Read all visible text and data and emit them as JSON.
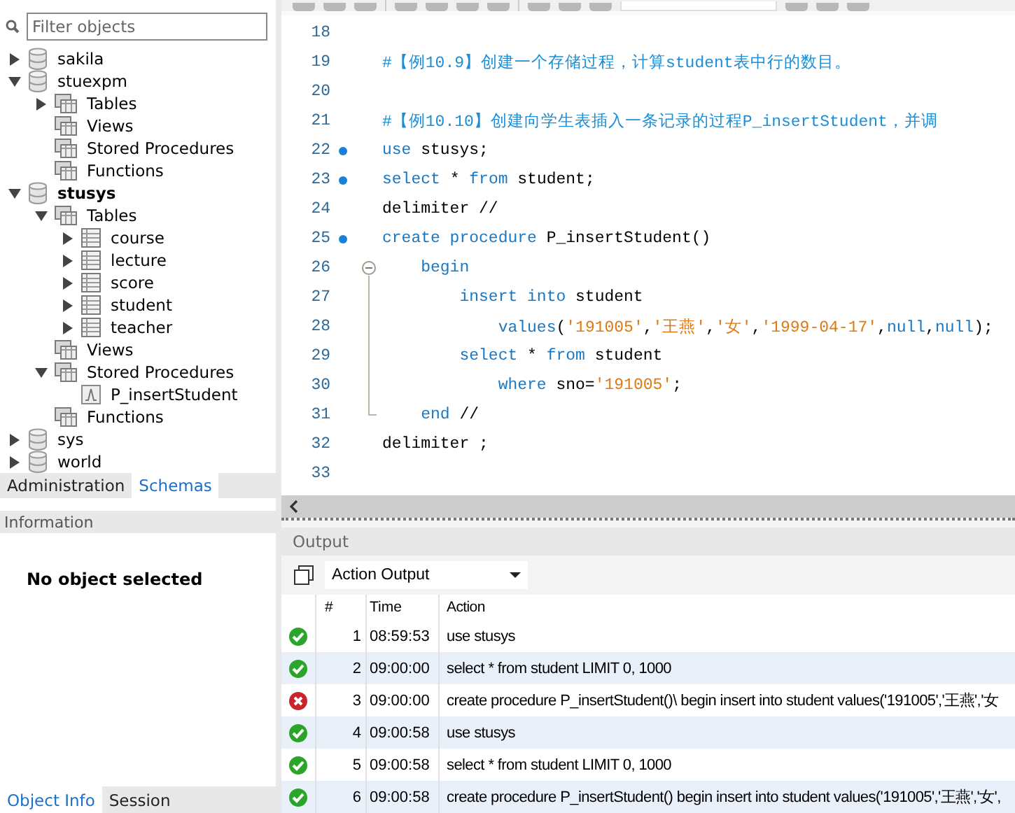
{
  "sidebar": {
    "filter": {
      "placeholder": "Filter objects"
    },
    "tree": [
      {
        "label": "sakila",
        "kind": "schema",
        "default_schema": false,
        "expanded": false
      },
      {
        "label": "stuexpm",
        "kind": "schema",
        "default_schema": false,
        "expanded": true,
        "children": [
          {
            "label": "Tables",
            "kind": "group",
            "expanded": false
          },
          {
            "label": "Views",
            "kind": "group"
          },
          {
            "label": "Stored Procedures",
            "kind": "group"
          },
          {
            "label": "Functions",
            "kind": "group"
          }
        ]
      },
      {
        "label": "stusys",
        "kind": "schema",
        "default_schema": true,
        "expanded": true,
        "children": [
          {
            "label": "Tables",
            "kind": "group",
            "expanded": true,
            "children": [
              {
                "label": "course",
                "kind": "table",
                "expanded": false
              },
              {
                "label": "lecture",
                "kind": "table",
                "expanded": false
              },
              {
                "label": "score",
                "kind": "table",
                "expanded": false
              },
              {
                "label": "student",
                "kind": "table",
                "expanded": false
              },
              {
                "label": "teacher",
                "kind": "table",
                "expanded": false
              }
            ]
          },
          {
            "label": "Views",
            "kind": "group"
          },
          {
            "label": "Stored Procedures",
            "kind": "group",
            "expanded": true,
            "children": [
              {
                "label": "P_insertStudent",
                "kind": "routine"
              }
            ]
          },
          {
            "label": "Functions",
            "kind": "group"
          }
        ]
      },
      {
        "label": "sys",
        "kind": "schema",
        "default_schema": false,
        "expanded": false
      },
      {
        "label": "world",
        "kind": "schema",
        "default_schema": false,
        "expanded": false
      }
    ],
    "tabs": [
      {
        "label": "Administration",
        "selected": false
      },
      {
        "label": "Schemas",
        "selected": true
      }
    ],
    "info_title": "Information",
    "info_text": "No object selected",
    "bottom_tabs": [
      {
        "label": "Object Info",
        "selected": true
      },
      {
        "label": "Session",
        "selected": false
      }
    ]
  },
  "editor": {
    "lines": [
      {
        "num": "18",
        "kind": "plain",
        "marker": false
      },
      {
        "num": "19",
        "kind": "plain",
        "marker": false,
        "tokens": [
          {
            "kind": "comment",
            "s": "#【例10.9】创建一个存储过程，计算student表中行的数目。"
          }
        ]
      },
      {
        "num": "20",
        "kind": "plain",
        "marker": false
      },
      {
        "num": "21",
        "kind": "plain",
        "marker": false,
        "tokens": [
          {
            "kind": "comment",
            "s": "#【例10.10】创建向学生表插入一条记录的过程P_insertStudent，并调"
          }
        ]
      },
      {
        "num": "22",
        "kind": "plain",
        "marker": true,
        "tokens": [
          {
            "kind": "kw",
            "s": "use"
          },
          {
            "kind": "plain",
            "s": " stusys;"
          }
        ]
      },
      {
        "num": "23",
        "kind": "plain",
        "marker": true,
        "tokens": [
          {
            "kind": "kw",
            "s": "select"
          },
          {
            "kind": "plain",
            "s": " * "
          },
          {
            "kind": "kw",
            "s": "from"
          },
          {
            "kind": "plain",
            "s": " student;"
          }
        ]
      },
      {
        "num": "24",
        "kind": "plain",
        "marker": false,
        "tokens": [
          {
            "kind": "plain",
            "s": "delimiter //"
          }
        ]
      },
      {
        "num": "25",
        "kind": "plain",
        "marker": true,
        "tokens": [
          {
            "kind": "kw",
            "s": "create procedure"
          },
          {
            "kind": "plain",
            "s": " P_insertStudent()"
          }
        ]
      },
      {
        "num": "26",
        "kind": "fold_start",
        "marker": false,
        "tokens": [
          {
            "kind": "kw",
            "s": "    begin"
          }
        ]
      },
      {
        "num": "27",
        "kind": "fold_body",
        "marker": false,
        "tokens": [
          {
            "kind": "kw",
            "s": "        insert into"
          },
          {
            "kind": "plain",
            "s": " student"
          }
        ]
      },
      {
        "num": "28",
        "kind": "fold_body",
        "marker": false,
        "tokens": [
          {
            "kind": "kw",
            "s": "            values"
          },
          {
            "kind": "plain",
            "s": "("
          },
          {
            "kind": "str",
            "s": "'191005'"
          },
          {
            "kind": "plain",
            "s": ","
          },
          {
            "kind": "str",
            "s": "'王燕'"
          },
          {
            "kind": "plain",
            "s": ","
          },
          {
            "kind": "str",
            "s": "'女'"
          },
          {
            "kind": "plain",
            "s": ","
          },
          {
            "kind": "str",
            "s": "'1999-04-17'"
          },
          {
            "kind": "plain",
            "s": ","
          },
          {
            "kind": "kw",
            "s": "null"
          },
          {
            "kind": "plain",
            "s": ","
          },
          {
            "kind": "kw",
            "s": "null"
          },
          {
            "kind": "plain",
            "s": ");"
          }
        ]
      },
      {
        "num": "29",
        "kind": "fold_body",
        "marker": false,
        "tokens": [
          {
            "kind": "kw",
            "s": "        select"
          },
          {
            "kind": "plain",
            "s": " * "
          },
          {
            "kind": "kw",
            "s": "from"
          },
          {
            "kind": "plain",
            "s": " student"
          }
        ]
      },
      {
        "num": "30",
        "kind": "fold_body",
        "marker": false,
        "tokens": [
          {
            "kind": "kw",
            "s": "            where"
          },
          {
            "kind": "plain",
            "s": " sno="
          },
          {
            "kind": "str",
            "s": "'191005'"
          },
          {
            "kind": "plain",
            "s": ";"
          }
        ]
      },
      {
        "num": "31",
        "kind": "fold_end",
        "marker": false,
        "tokens": [
          {
            "kind": "kw",
            "s": "    end"
          },
          {
            "kind": "plain",
            "s": " //"
          }
        ]
      },
      {
        "num": "32",
        "kind": "plain",
        "marker": false,
        "tokens": [
          {
            "kind": "plain",
            "s": "delimiter ;"
          }
        ]
      },
      {
        "num": "33",
        "kind": "plain",
        "marker": false
      }
    ]
  },
  "output": {
    "title": "Output",
    "selector": "Action Output",
    "columns": [
      "#",
      "Time",
      "Action"
    ],
    "rows": [
      {
        "failed": false,
        "num": "1",
        "time": "08:59:53",
        "action": "use stusys"
      },
      {
        "failed": false,
        "num": "2",
        "time": "09:00:00",
        "action": "select * from student LIMIT 0, 1000"
      },
      {
        "failed": true,
        "num": "3",
        "time": "09:00:00",
        "action": "create procedure P_insertStudent()\\ begin insert into student values('191005','王燕','女"
      },
      {
        "failed": false,
        "num": "4",
        "time": "09:00:58",
        "action": "use stusys"
      },
      {
        "failed": false,
        "num": "5",
        "time": "09:00:58",
        "action": "select * from student LIMIT 0, 1000"
      },
      {
        "failed": false,
        "num": "6",
        "time": "09:00:58",
        "action": "create procedure P_insertStudent() begin insert into student values('191005','王燕','女',"
      }
    ]
  }
}
